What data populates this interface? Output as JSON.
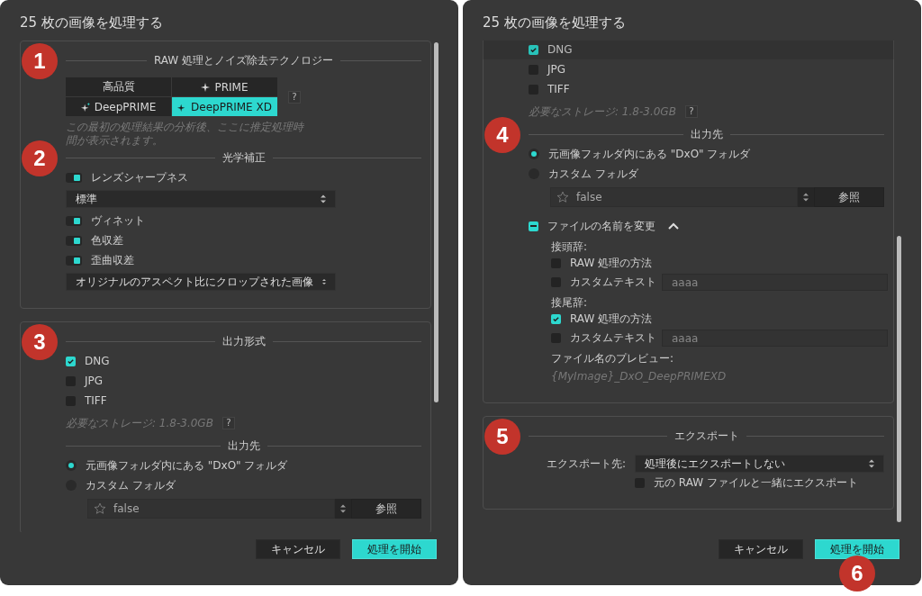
{
  "dialogs": [
    {
      "title": "25 枚の画像を処理する",
      "groups": [
        {
          "blocks": [
            {
              "kind": "heading",
              "text": "RAW 処理とノイズ除去テクノロジー",
              "badge": "1"
            },
            {
              "kind": "segmented",
              "help": "?",
              "options": [
                {
                  "label": "高品質",
                  "selected": false
                },
                {
                  "label": "PRIME",
                  "selected": false
                },
                {
                  "label": "DeepPRIME",
                  "selected": false
                },
                {
                  "label": "DeepPRIME XD",
                  "selected": true
                }
              ]
            },
            {
              "kind": "hint",
              "text": "この最初の処理結果の分析後、ここに推定処理時間が表示されます。"
            },
            {
              "kind": "heading",
              "text": "光学補正",
              "badge": "2"
            },
            {
              "kind": "toggle",
              "label": "レンズシャープネス",
              "on": true
            },
            {
              "kind": "select",
              "value": "標準"
            },
            {
              "kind": "toggle",
              "label": "ヴィネット",
              "on": true
            },
            {
              "kind": "toggle",
              "label": "色収差",
              "on": true
            },
            {
              "kind": "toggle",
              "label": "歪曲収差",
              "on": true
            },
            {
              "kind": "select",
              "value": "オリジナルのアスペクト比にクロップされた画像"
            }
          ]
        },
        {
          "blocks": [
            {
              "kind": "heading",
              "text": "出力形式",
              "badge": "3"
            },
            {
              "kind": "checkbox",
              "label": "DNG",
              "checked": true
            },
            {
              "kind": "checkbox",
              "label": "JPG",
              "checked": false
            },
            {
              "kind": "checkbox",
              "label": "TIFF",
              "checked": false
            },
            {
              "kind": "storage",
              "text": "必要なストレージ: 1.8-3.0GB",
              "help": "?"
            },
            {
              "kind": "heading",
              "text": "出力先"
            },
            {
              "kind": "radio",
              "label": "元画像フォルダ内にある \"DxO\" フォルダ",
              "selected": true
            },
            {
              "kind": "radio",
              "label": "カスタム フォルダ",
              "selected": false
            },
            {
              "kind": "folder",
              "value": "false",
              "button": "参照"
            }
          ]
        }
      ],
      "buttons": [
        {
          "label": "キャンセル",
          "primary": false
        },
        {
          "label": "処理を開始",
          "primary": true
        }
      ]
    },
    {
      "title": "25 枚の画像を処理する",
      "groups": [
        {
          "blocks": [
            {
              "kind": "checkbox",
              "label": "DNG",
              "checked": true
            },
            {
              "kind": "checkbox",
              "label": "JPG",
              "checked": false
            },
            {
              "kind": "checkbox",
              "label": "TIFF",
              "checked": false
            },
            {
              "kind": "storage",
              "text": "必要なストレージ: 1.8-3.0GB",
              "help": "?"
            },
            {
              "kind": "heading",
              "text": "出力先",
              "badge": "4"
            },
            {
              "kind": "radio",
              "label": "元画像フォルダ内にある \"DxO\" フォルダ",
              "selected": true
            },
            {
              "kind": "radio",
              "label": "カスタム フォルダ",
              "selected": false
            },
            {
              "kind": "folder",
              "value": "false",
              "button": "参照"
            },
            {
              "kind": "rename",
              "label": "ファイルの名前を変更",
              "checked": true,
              "mixed": true,
              "expanded": true,
              "children": [
                {
                  "kind": "sublabel",
                  "text": "接頭辞:"
                },
                {
                  "kind": "checkbox",
                  "label": "RAW 処理の方法",
                  "checked": false
                },
                {
                  "kind": "checkfield",
                  "label": "カスタムテキスト",
                  "checked": false,
                  "placeholder": "aaaa"
                },
                {
                  "kind": "sublabel",
                  "text": "接尾辞:"
                },
                {
                  "kind": "checkbox",
                  "label": "RAW 処理の方法",
                  "checked": true
                },
                {
                  "kind": "checkfield",
                  "label": "カスタムテキスト",
                  "checked": false,
                  "placeholder": "aaaa"
                },
                {
                  "kind": "sublabel",
                  "text": "ファイル名のプレビュー:"
                },
                {
                  "kind": "preview",
                  "text": "{MyImage}_DxO_DeepPRIMEXD"
                }
              ]
            }
          ]
        },
        {
          "blocks": [
            {
              "kind": "heading",
              "text": "エクスポート",
              "badge": "5"
            },
            {
              "kind": "labeled_select",
              "label": "エクスポート先:",
              "value": "処理後にエクスポートしない",
              "option": {
                "label": "元の RAW ファイルと一緒にエクスポート",
                "checked": false
              }
            }
          ]
        }
      ],
      "buttons": [
        {
          "label": "キャンセル",
          "primary": false
        },
        {
          "label": "処理を開始",
          "primary": true,
          "badge": "6"
        }
      ]
    }
  ]
}
